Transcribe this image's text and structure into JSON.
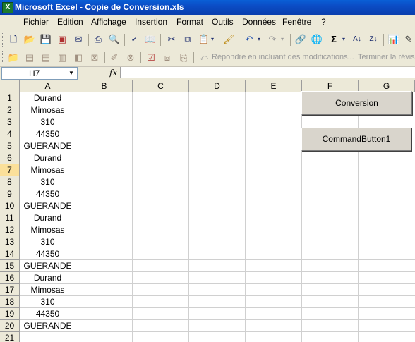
{
  "window": {
    "title": "Microsoft Excel - Copie de Conversion.xls",
    "icon": "excel-icon"
  },
  "menubar": {
    "items": [
      "Fichier",
      "Edition",
      "Affichage",
      "Insertion",
      "Format",
      "Outils",
      "Données",
      "Fenêtre",
      "?"
    ]
  },
  "standard_toolbar": {
    "icons": [
      "new-icon",
      "open-icon",
      "save-icon",
      "permission-icon",
      "email-icon",
      "print-icon",
      "print-preview-icon",
      "spelling-icon",
      "research-icon",
      "cut-icon",
      "copy-icon",
      "paste-icon",
      "format-painter-icon",
      "undo-icon",
      "redo-icon",
      "hyperlink-icon",
      "web-icon",
      "autosum-icon",
      "sort-ascending-icon",
      "sort-descending-icon",
      "chart-wizard-icon",
      "drawing-icon"
    ],
    "autosum_glyph": "Σ"
  },
  "reviewing_toolbar": {
    "reply_label": "Répondre en incluant des modifications...",
    "end_review_label": "Terminer la révisi"
  },
  "formula_bar": {
    "name_box": "H7",
    "fx_label": "fx",
    "formula": ""
  },
  "columns": [
    "A",
    "B",
    "C",
    "D",
    "E",
    "F",
    "G"
  ],
  "rows": [
    "1",
    "2",
    "3",
    "4",
    "5",
    "6",
    "7",
    "8",
    "9",
    "10",
    "11",
    "12",
    "13",
    "14",
    "15",
    "16",
    "17",
    "18",
    "19",
    "20",
    "21"
  ],
  "selected_row": "7",
  "column_a": [
    "Durand",
    "Mimosas",
    "310",
    "44350",
    "GUERANDE",
    "Durand",
    "Mimosas",
    "310",
    "44350",
    "GUERANDE",
    "Durand",
    "Mimosas",
    "310",
    "44350",
    "GUERANDE",
    "Durand",
    "Mimosas",
    "310",
    "44350",
    "GUERANDE",
    ""
  ],
  "buttons": {
    "conversion": "Conversion",
    "command_button1": "CommandButton1"
  }
}
